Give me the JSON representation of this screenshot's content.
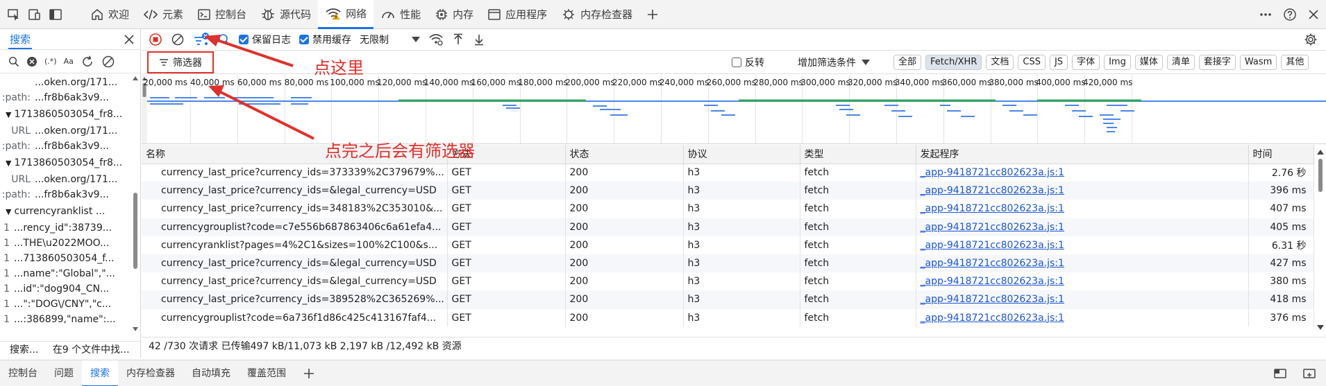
{
  "top_tabs": [
    {
      "label": "欢迎",
      "icon": "home-icon"
    },
    {
      "label": "元素",
      "icon": "code-icon"
    },
    {
      "label": "控制台",
      "icon": "console-icon"
    },
    {
      "label": "源代码",
      "icon": "bug-icon"
    },
    {
      "label": "网络",
      "icon": "wifi-icon",
      "active": true
    },
    {
      "label": "性能",
      "icon": "gauge-icon"
    },
    {
      "label": "内存",
      "icon": "chip-icon"
    },
    {
      "label": "应用程序",
      "icon": "app-window-icon"
    },
    {
      "label": "内存检查器",
      "icon": "memory-inspector-icon"
    }
  ],
  "search_panel": {
    "title": "搜索",
    "options": {
      "regex": "(.*)",
      "case": "Aa"
    },
    "results": [
      {
        "kind": "line",
        "key": "",
        "value": "...oken.org/171..."
      },
      {
        "kind": "line",
        "key": ":path:",
        "value": "...fr8b6ak3v9..."
      },
      {
        "kind": "group",
        "key": "",
        "value": "1713860503054_fr8..."
      },
      {
        "kind": "line",
        "key": "URL",
        "value": "...oken.org/171..."
      },
      {
        "kind": "line",
        "key": ":path:",
        "value": "...fr8b6ak3v9..."
      },
      {
        "kind": "group",
        "key": "",
        "value": "1713860503054_fr8..."
      },
      {
        "kind": "line",
        "key": "URL",
        "value": "...oken.org/171..."
      },
      {
        "kind": "line",
        "key": ":path:",
        "value": "...fr8b6ak3v9..."
      },
      {
        "kind": "group",
        "key": "",
        "value": "currencyranklist     ..."
      },
      {
        "kind": "num",
        "key": "1",
        "value": "...rency_id\":38739..."
      },
      {
        "kind": "num",
        "key": "1",
        "value": "...THE\\u2022MOO..."
      },
      {
        "kind": "num",
        "key": "1",
        "value": "...713860503054_f..."
      },
      {
        "kind": "num",
        "key": "1",
        "value": "...name\":\"Global\",\"..."
      },
      {
        "kind": "num",
        "key": "1",
        "value": "...id\":\"dog904_CN..."
      },
      {
        "kind": "num",
        "key": "1",
        "value": "...\":\"DOG\\/CNY\",\"c..."
      },
      {
        "kind": "num",
        "key": "1",
        "value": "...:386899,\"name\":..."
      }
    ],
    "status_left": "搜索...",
    "status_right": "在9 个文件中找..."
  },
  "network_toolbar": {
    "preserve_log": "保留日志",
    "disable_cache": "禁用缓存",
    "throttling": "无限制"
  },
  "filter_row": {
    "filter_button": "筛选器",
    "invert": "反转",
    "more_filters": "增加筛选条件",
    "types": [
      "全部",
      "Fetch/XHR",
      "文档",
      "CSS",
      "JS",
      "字体",
      "Img",
      "媒体",
      "清单",
      "套接字",
      "Wasm",
      "其他"
    ],
    "active_type": "Fetch/XHR"
  },
  "timeline": {
    "ticks": [
      "20,000 ms",
      "40,000 ms",
      "60,000 ms",
      "80,000 ms",
      "100,000 ms",
      "120,000 ms",
      "140,000 ms",
      "160,000 ms",
      "180,000 ms",
      "200,000 ms",
      "220,000 ms",
      "240,000 ms",
      "260,000 ms",
      "280,000 ms",
      "300,000 ms",
      "320,000 ms",
      "340,000 ms",
      "360,000 ms",
      "380,000 ms",
      "400,000 ms",
      "420,000 ms"
    ],
    "colors": {
      "waterfall_blue": "#4a86e8",
      "waterfall_green": "#34a853"
    }
  },
  "table": {
    "headers": [
      "名称",
      "方法",
      "状态",
      "协议",
      "类型",
      "发起程序",
      "时间"
    ],
    "rows": [
      [
        "currency_last_price?currency_ids=373339%2C379679%...",
        "GET",
        "200",
        "h3",
        "fetch",
        "_app-9418721cc802623a.js:1",
        "2.76 秒"
      ],
      [
        "currency_last_price?currency_ids=&legal_currency=USD",
        "GET",
        "200",
        "h3",
        "fetch",
        "_app-9418721cc802623a.js:1",
        "396 ms"
      ],
      [
        "currency_last_price?currency_ids=348183%2C353010&...",
        "GET",
        "200",
        "h3",
        "fetch",
        "_app-9418721cc802623a.js:1",
        "407 ms"
      ],
      [
        "currencygrouplist?code=c7e556b687863406c6a61efa4...",
        "GET",
        "200",
        "h3",
        "fetch",
        "_app-9418721cc802623a.js:1",
        "405 ms"
      ],
      [
        "currencyranklist?pages=4%2C1&sizes=100%2C100&s...",
        "GET",
        "200",
        "h3",
        "fetch",
        "_app-9418721cc802623a.js:1",
        "6.31 秒"
      ],
      [
        "currency_last_price?currency_ids=&legal_currency=USD",
        "GET",
        "200",
        "h3",
        "fetch",
        "_app-9418721cc802623a.js:1",
        "427 ms"
      ],
      [
        "currency_last_price?currency_ids=&legal_currency=USD",
        "GET",
        "200",
        "h3",
        "fetch",
        "_app-9418721cc802623a.js:1",
        "380 ms"
      ],
      [
        "currency_last_price?currency_ids=389528%2C365269%...",
        "GET",
        "200",
        "h3",
        "fetch",
        "_app-9418721cc802623a.js:1",
        "418 ms"
      ],
      [
        "currencygrouplist?code=6a736f1d86c425c413167faf4...",
        "GET",
        "200",
        "h3",
        "fetch",
        "_app-9418721cc802623a.js:1",
        "376 ms"
      ]
    ]
  },
  "summary": "42 /730 次请求   已传输497 kB/11,073 kB   2,197 kB /12,492 kB 资源",
  "drawer_tabs": [
    "控制台",
    "问题",
    "搜索",
    "内存检查器",
    "自动填充",
    "覆盖范围"
  ],
  "drawer_active": "搜索",
  "annotations": {
    "click_here": "点这里",
    "after_click": "点完之后会有筛选器",
    "color": "#e0302b"
  }
}
